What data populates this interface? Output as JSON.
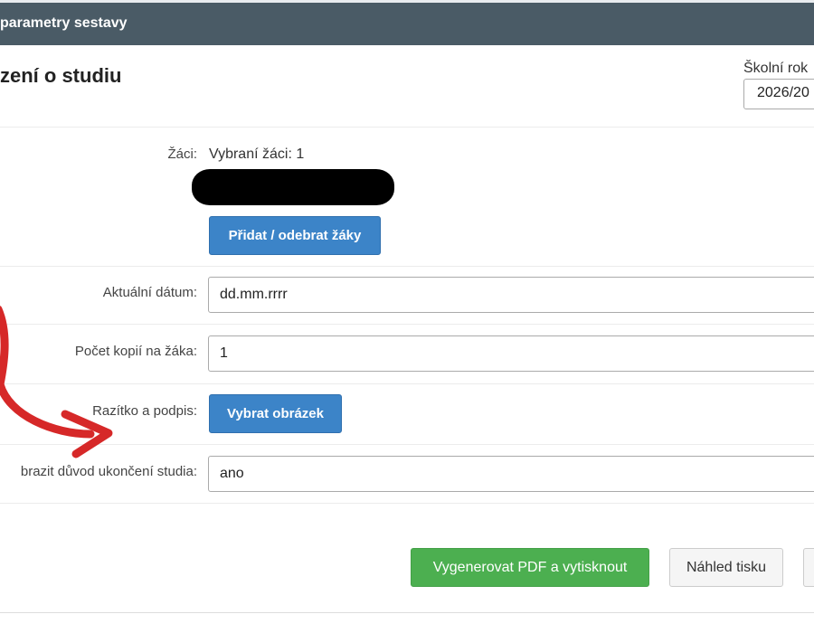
{
  "dialog": {
    "title": "parametry sestavy",
    "heading": "zení o studiu"
  },
  "school_year": {
    "label": "Školní rok",
    "value": "2026/20"
  },
  "students": {
    "label": "Žáci:",
    "selected_text": "Vybraní žáci: 1",
    "add_remove_label": "Přidat / odebrat žáky"
  },
  "current_date": {
    "label": "Aktuální dátum:",
    "value": "dd.mm.rrrr"
  },
  "copies": {
    "label": "Počet kopií na žáka:",
    "value": "1"
  },
  "stamp": {
    "label": "Razítko a podpis:",
    "button_label": "Vybrat obrázek"
  },
  "reason": {
    "label": "brazit důvod ukončení studia:",
    "value": "ano"
  },
  "footer": {
    "generate_label": "Vygenerovat PDF a vytisknout",
    "preview_label": "Náhled tisku"
  },
  "colors": {
    "titlebar": "#4a5b66",
    "primary": "#3c84c8",
    "success": "#4caf50",
    "annotation_arrow": "#d62828"
  }
}
